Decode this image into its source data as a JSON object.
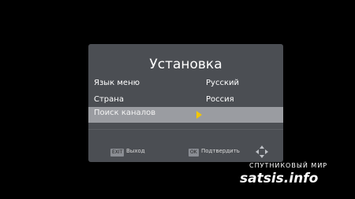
{
  "screen": {
    "title": "Установка",
    "items": [
      {
        "label": "Язык меню",
        "value": "Русский"
      },
      {
        "label": "Страна",
        "value": "Россия"
      },
      {
        "label": "Поиск каналов",
        "value": ""
      }
    ]
  },
  "footer": {
    "exit_key": "EXIT",
    "exit_label": "Выход",
    "ok_key": "OK",
    "ok_label": "Подтвердить"
  },
  "watermark": {
    "top": "СПУТНИКОВЫЙ МИР",
    "main": "satsis.info"
  },
  "colors": {
    "panel": "#4b4e53",
    "selected_row": "#9a9ca1",
    "accent_arrow": "#f2c600"
  }
}
